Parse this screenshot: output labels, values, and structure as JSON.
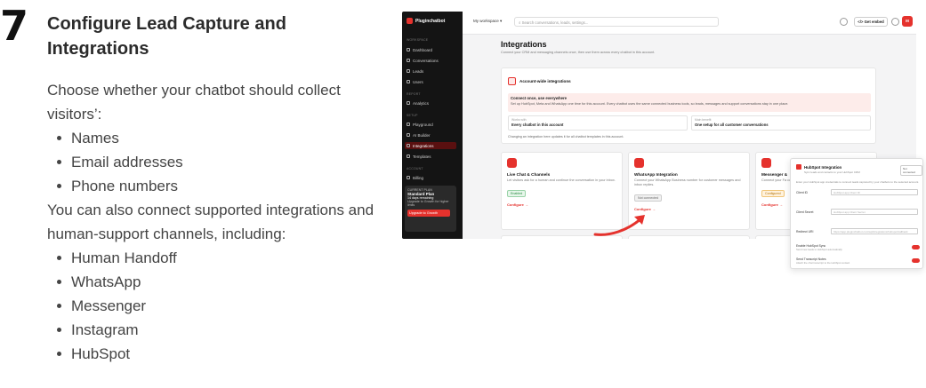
{
  "step": {
    "number": "7",
    "title": "Configure Lead Capture and Integrations",
    "intro": "Choose whether your chatbot should collect visitors’:",
    "collect_items": [
      "Names",
      "Email addresses",
      "Phone numbers"
    ],
    "connect_text": "You can also connect supported integrations and human-support channels, including:",
    "channel_items": [
      "Human Handoff",
      "WhatsApp",
      "Messenger",
      "Instagram",
      "HubSpot"
    ]
  },
  "app": {
    "brand": "Pluginchatbot",
    "workspace": "My workspace",
    "search_placeholder": "Search conversations, leads, settings...",
    "get_embed": "Get embed",
    "avatar": "M",
    "sidebar": {
      "workspace_label": "WORKSPACE",
      "report_label": "REPORT",
      "setup_label": "SETUP",
      "account_label": "ACCOUNT",
      "items": [
        "Dashboard",
        "Conversations",
        "Leads",
        "Users",
        "Analytics",
        "Playground",
        "AI Builder",
        "Integrations",
        "Templates",
        "Billing"
      ],
      "plan_label": "CURRENT PLAN",
      "plan_name": "Standard Plan",
      "plan_days": "14 days remaining",
      "plan_desc": "Upgrade to Growth for higher limits",
      "upgrade": "Upgrade to Growth"
    },
    "page_title": "Integrations",
    "page_subtitle": "Connect your CRM and messaging channels once, then use them across every chatbot in this account.",
    "account_card": {
      "title": "Account-wide integrations",
      "note_title": "Connect once, use everywhere",
      "note_text": "Set up HubSpot, Meta and WhatsApp one time for this account. Every chatbot uses the same connected business tools, so leads, messages and support conversations stay in one place.",
      "box1_label": "Works with",
      "box1_value": "Every chatbot in this account",
      "box2_label": "Main benefit",
      "box2_value": "One setup for all customer conversations",
      "change_note": "Changing an integration here updates it for all chatbot templates in this account."
    },
    "cards": [
      {
        "title": "Live Chat & Channels",
        "desc": "Let visitors ask for a human and continue the conversation in your inbox.",
        "badge": "Enabled",
        "action": "Configure →"
      },
      {
        "title": "WhatsApp Integration",
        "desc": "Connect your WhatsApp Business number for customer messages and inbox replies.",
        "badge": "Not connected",
        "action": "Configure →"
      },
      {
        "title": "Messenger &",
        "desc": "Connect your Fa customer conver",
        "badge": "Configured",
        "action": "Configure →"
      }
    ],
    "hubspot_panel": {
      "title": "HubSpot Integration",
      "subtitle": "Sync leads and contacts to your HubSpot CRM",
      "chip": "Not connected",
      "intro": "Enter your HubSpot app credentials to connect leads captured by your chatbots to the selected account.",
      "fields": [
        {
          "label": "Client ID",
          "placeholder": "HubSpot app Client ID"
        },
        {
          "label": "Client Secret",
          "placeholder": "HubSpot app Client Secret"
        },
        {
          "label": "Redirect URI",
          "placeholder": "https://app.pluginchatbot.com/api/integrations/hubspot/callback"
        }
      ],
      "toggle1": "Enable HubSpot Sync",
      "toggle1_desc": "Send new leads to HubSpot automatically",
      "toggle2": "Send Transcript Notes",
      "toggle2_desc": "Attach the chat transcript to the HubSpot contact"
    }
  },
  "colors": {
    "accent": "#e5322d",
    "sidebar": "#141414",
    "enabled": "#2a8c43",
    "configured": "#b37308"
  }
}
